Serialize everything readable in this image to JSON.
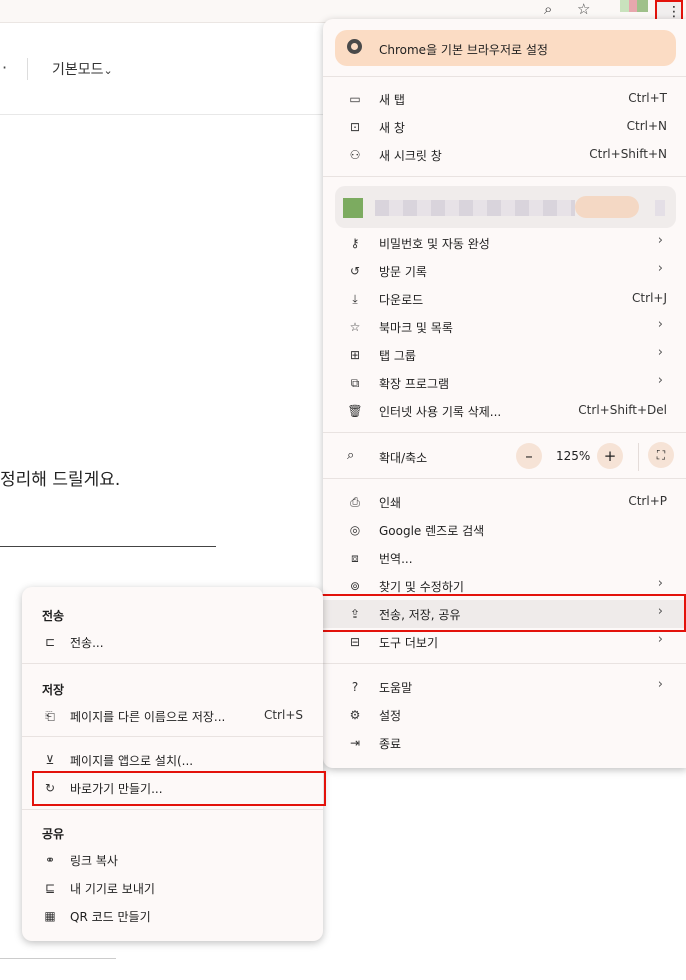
{
  "page": {
    "mode_label": "기본모드",
    "mode_chevron": "⌄",
    "dot": "·",
    "body_text": "정리해 드릴게요."
  },
  "menu": {
    "default_banner": "Chrome을 기본 브라우저로 설정",
    "group1": [
      {
        "label": "새 탭",
        "shortcut": "Ctrl+T",
        "icon": "new-tab-icon"
      },
      {
        "label": "새 창",
        "shortcut": "Ctrl+N",
        "icon": "new-window-icon"
      },
      {
        "label": "새 시크릿 창",
        "shortcut": "Ctrl+Shift+N",
        "icon": "incognito-icon"
      }
    ],
    "group2": [
      {
        "label": "비밀번호 및 자동 완성",
        "icon": "key-icon"
      },
      {
        "label": "방문 기록",
        "icon": "history-icon"
      },
      {
        "label": "다운로드",
        "shortcut": "Ctrl+J",
        "icon": "download-icon"
      },
      {
        "label": "북마크 및 목록",
        "icon": "star-icon"
      },
      {
        "label": "탭 그룹",
        "icon": "tab-groups-icon"
      },
      {
        "label": "확장 프로그램",
        "icon": "extension-icon"
      },
      {
        "label": "인터넷 사용 기록 삭제...",
        "shortcut": "Ctrl+Shift+Del",
        "icon": "trash-icon"
      }
    ],
    "zoom": {
      "label": "확대/축소",
      "value": "125%",
      "minus": "–",
      "plus": "+"
    },
    "group3": [
      {
        "label": "인쇄",
        "shortcut": "Ctrl+P",
        "icon": "print-icon"
      },
      {
        "label": "Google 렌즈로 검색",
        "icon": "lens-icon"
      },
      {
        "label": "번역...",
        "icon": "translate-icon"
      },
      {
        "label": "찾기 및 수정하기",
        "icon": "find-icon"
      },
      {
        "label": "전송, 저장, 공유",
        "icon": "share-icon"
      },
      {
        "label": "도구 더보기",
        "icon": "toolbox-icon"
      }
    ],
    "group4": [
      {
        "label": "도움말",
        "icon": "help-icon"
      },
      {
        "label": "설정",
        "icon": "gear-icon"
      },
      {
        "label": "종료",
        "icon": "exit-icon"
      }
    ],
    "chevron": "›"
  },
  "submenu": {
    "cast_header": "전송",
    "cast_label": "전송...",
    "save_header": "저장",
    "save_as_label": "페이지를 다른 이름으로 저장...",
    "save_as_shortcut": "Ctrl+S",
    "install_label": "페이지를 앱으로 설치(...",
    "shortcut_label": "바로가기 만들기...",
    "share_header": "공유",
    "copy_link_label": "링크 복사",
    "send_device_label": "내 기기로 보내기",
    "qr_label": "QR 코드 만들기"
  }
}
